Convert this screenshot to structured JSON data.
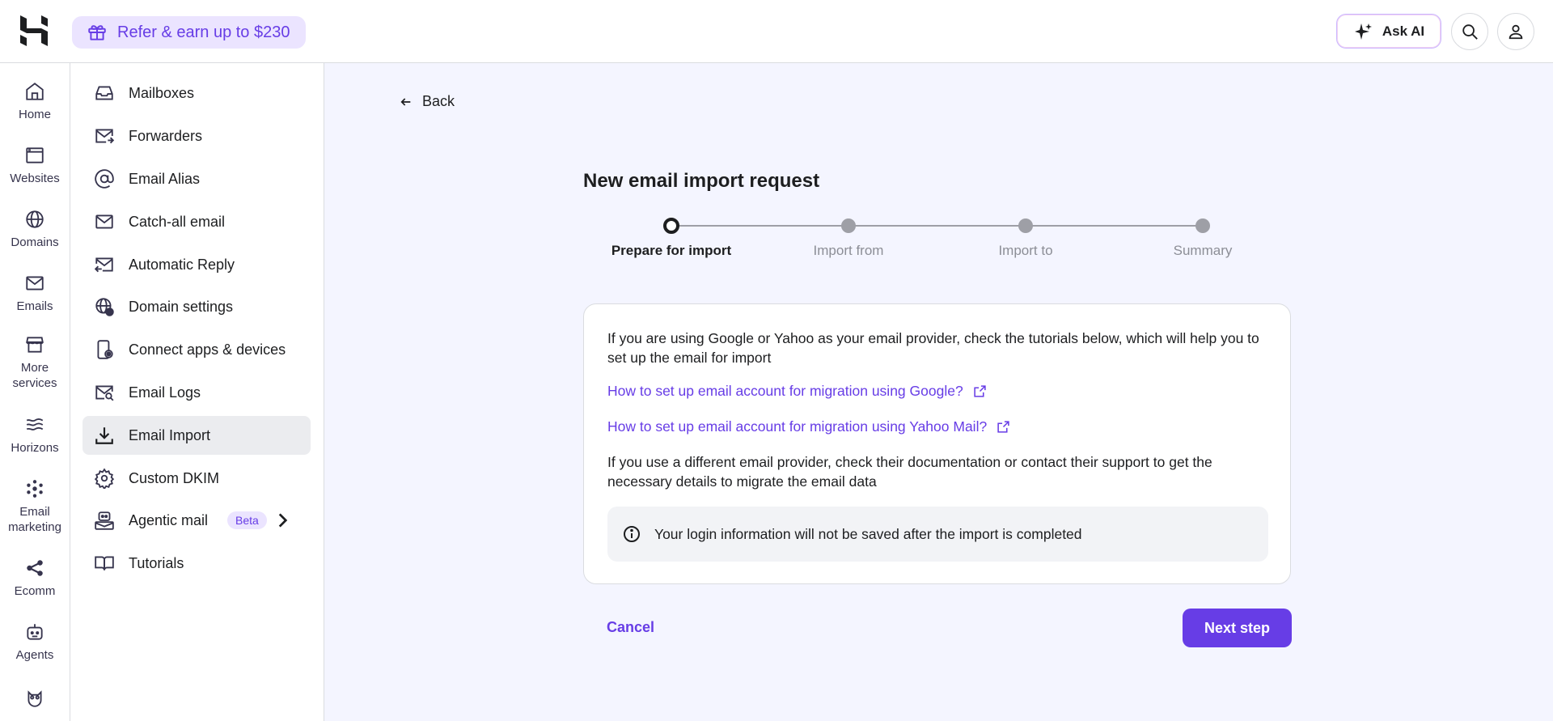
{
  "topbar": {
    "refer_label": "Refer & earn up to $230",
    "ask_ai_label": "Ask AI"
  },
  "rail": [
    {
      "label": "Home",
      "icon": "home-icon"
    },
    {
      "label": "Websites",
      "icon": "browser-window-icon"
    },
    {
      "label": "Domains",
      "icon": "globe-icon"
    },
    {
      "label": "Emails",
      "icon": "mail-icon"
    },
    {
      "label": "More services",
      "icon": "store-icon"
    },
    {
      "label": "Horizons",
      "icon": "horizons-icon"
    },
    {
      "label": "Email marketing",
      "icon": "reach-icon"
    },
    {
      "label": "Ecomm",
      "icon": "ecomm-icon"
    },
    {
      "label": "Agents",
      "icon": "robot-icon"
    }
  ],
  "submenu": [
    {
      "label": "Mailboxes",
      "icon": "inbox-icon"
    },
    {
      "label": "Forwarders",
      "icon": "mail-forward-icon"
    },
    {
      "label": "Email Alias",
      "icon": "at-sign-icon"
    },
    {
      "label": "Catch-all email",
      "icon": "mail-icon"
    },
    {
      "label": "Automatic Reply",
      "icon": "mail-reply-icon"
    },
    {
      "label": "Domain settings",
      "icon": "globe-settings-icon"
    },
    {
      "label": "Connect apps & devices",
      "icon": "device-connect-icon"
    },
    {
      "label": "Email Logs",
      "icon": "mail-search-icon"
    },
    {
      "label": "Email Import",
      "icon": "download-icon",
      "active": true
    },
    {
      "label": "Custom DKIM",
      "icon": "gear-icon"
    },
    {
      "label": "Agentic mail",
      "icon": "agentic-mail-icon",
      "badge": "Beta"
    },
    {
      "label": "Tutorials",
      "icon": "book-icon"
    }
  ],
  "main": {
    "back_label": "Back",
    "title": "New email import request",
    "steps": [
      "Prepare for import",
      "Import from",
      "Import to",
      "Summary"
    ],
    "current_step": 0,
    "intro": "If you are using Google or Yahoo as your email provider, check the tutorials below, which will help you to set up the email for import",
    "link_google": "How to set up email account for migration using Google?",
    "link_yahoo": "How to set up email account for migration using Yahoo Mail?",
    "other_provider": "If you use a different email provider, check their documentation or contact their support to get the necessary details to migrate the email data",
    "notice": "Your login information will not be saved after the import is completed",
    "cancel_label": "Cancel",
    "next_label": "Next step"
  },
  "colors": {
    "accent": "#673de6",
    "accent_light": "#ebe4ff",
    "text": "#1d1e20"
  }
}
